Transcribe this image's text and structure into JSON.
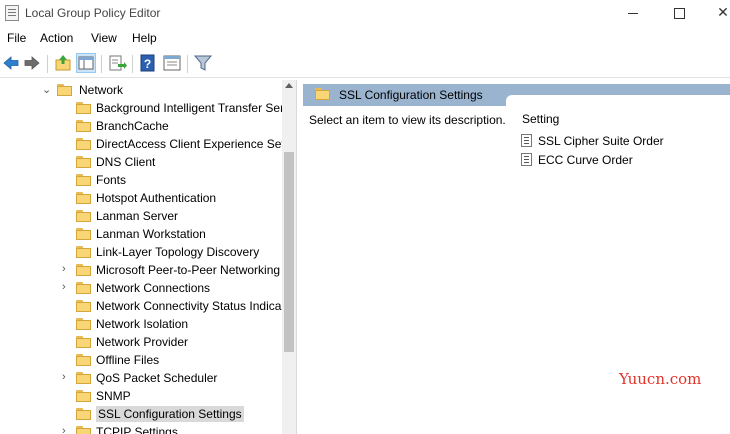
{
  "window": {
    "title": "Local Group Policy Editor",
    "controls": [
      "minimize",
      "maximize",
      "close"
    ]
  },
  "menu": [
    "File",
    "Action",
    "View",
    "Help"
  ],
  "toolbar": {
    "icons": [
      "back-arrow-icon",
      "forward-arrow-icon",
      "up-folder-icon",
      "show-hide-tree-icon",
      "export-list-icon",
      "help-icon",
      "properties-icon",
      "filter-icon"
    ],
    "active": "show-hide-tree-icon"
  },
  "tree": {
    "parent": "Network",
    "items": [
      {
        "label": "Background Intelligent Transfer Ser",
        "expandable": false
      },
      {
        "label": "BranchCache",
        "expandable": false
      },
      {
        "label": "DirectAccess Client Experience Setti",
        "expandable": false
      },
      {
        "label": "DNS Client",
        "expandable": false
      },
      {
        "label": "Fonts",
        "expandable": false
      },
      {
        "label": "Hotspot Authentication",
        "expandable": false
      },
      {
        "label": "Lanman Server",
        "expandable": false
      },
      {
        "label": "Lanman Workstation",
        "expandable": false
      },
      {
        "label": "Link-Layer Topology Discovery",
        "expandable": false
      },
      {
        "label": "Microsoft Peer-to-Peer Networking",
        "expandable": true
      },
      {
        "label": "Network Connections",
        "expandable": true
      },
      {
        "label": "Network Connectivity Status Indica",
        "expandable": false
      },
      {
        "label": "Network Isolation",
        "expandable": false
      },
      {
        "label": "Network Provider",
        "expandable": false
      },
      {
        "label": "Offline Files",
        "expandable": false
      },
      {
        "label": "QoS Packet Scheduler",
        "expandable": true
      },
      {
        "label": "SNMP",
        "expandable": false
      },
      {
        "label": "SSL Configuration Settings",
        "expandable": false,
        "selected": true
      },
      {
        "label": "TCPIP Settings",
        "expandable": true
      }
    ]
  },
  "detail": {
    "header": "SSL Configuration Settings",
    "description": "Select an item to view its description.",
    "column": "Setting",
    "settings": [
      "SSL Cipher Suite Order",
      "ECC Curve Order"
    ]
  },
  "watermark": "Yuucn.com",
  "colors": {
    "header": "#9ab4cf",
    "selection": "#d9d9d9",
    "watermark": "#e0342b"
  }
}
